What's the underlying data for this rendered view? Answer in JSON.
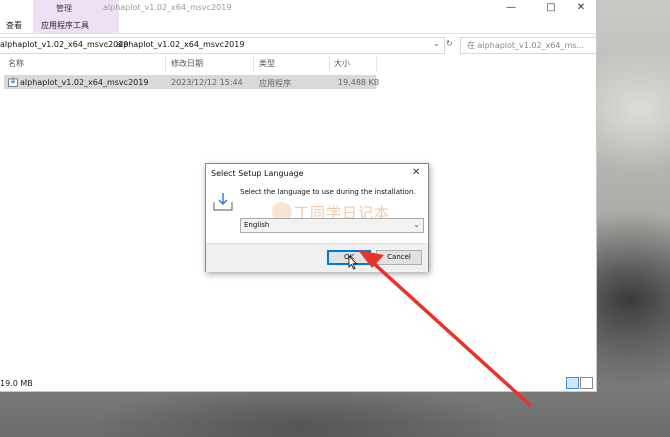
{
  "explorer": {
    "window_title": "alphaplot_v1.02_x64_msvc2019",
    "context_tab_label": "管理",
    "ribbon_tabs": [
      "查看",
      "应用程序工具"
    ],
    "address_segments": [
      "alphaplot_v1.02_x64_msvc2019",
      "alphaplot_v1.02_x64_msvc2019"
    ],
    "search_placeholder": "在 alphaplot_v1.02_x64_ms...",
    "columns": [
      "名称",
      "修改日期",
      "类型",
      "大小"
    ],
    "files": [
      {
        "name": "alphaplot_v1.02_x64_msvc2019",
        "modified": "2023/12/12 15:44",
        "type": "应用程序",
        "size": "19,488 KB"
      }
    ],
    "status_text": "19.0 MB"
  },
  "dialog": {
    "title": "Select Setup Language",
    "message": "Select the language to use during the installation.",
    "selected_language": "English",
    "ok_label": "OK",
    "cancel_label": "Cancel",
    "watermark": "丁同学日记本"
  },
  "icons": {
    "minimize": "minimize-icon",
    "maximize": "maximize-icon",
    "close": "close-icon"
  },
  "colors": {
    "context_tab": "#efe1f5",
    "selected_row": "#d9d9d9",
    "ok_border": "#0078d7",
    "arrow": "#e8332a"
  }
}
